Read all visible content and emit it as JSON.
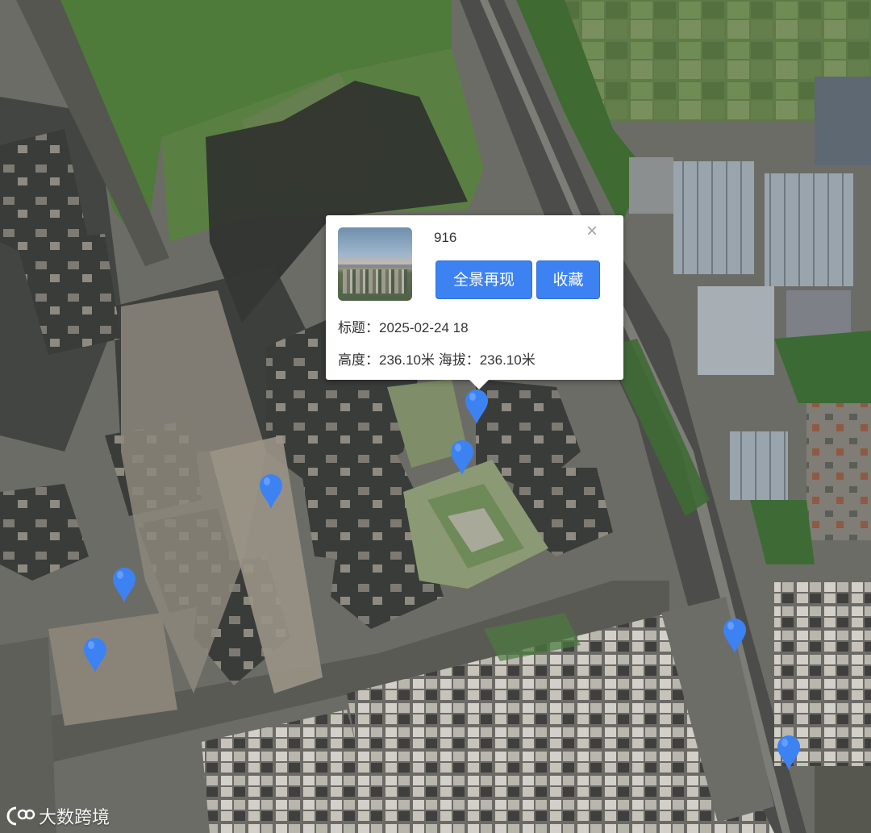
{
  "map": {
    "accent_color": "#3d82f2",
    "marker_color": "#3d82f2",
    "marker_count": 7
  },
  "popup": {
    "title": "916",
    "thumbnail_icon": "panorama-thumbnail",
    "close_label": "×",
    "panorama_button": "全景再现",
    "favorite_button": "收藏",
    "title_line": "标题：2025-02-24 18",
    "height_line": "高度：236.10米 海拔：236.10米"
  },
  "watermark": {
    "text": "大数跨境",
    "icon": "logo-icon"
  }
}
